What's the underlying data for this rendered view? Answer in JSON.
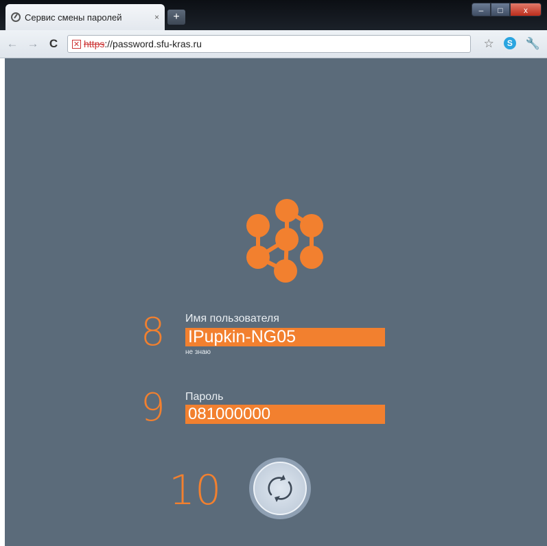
{
  "browser": {
    "tab_title": "Сервис смены паролей",
    "tab_close": "×",
    "new_tab": "+",
    "window_controls": {
      "minimize": "–",
      "maximize": "□",
      "close": "x"
    },
    "toolbar": {
      "back": "←",
      "forward": "→",
      "reload": "C",
      "url_scheme": "https",
      "url_rest": "://password.sfu-kras.ru"
    }
  },
  "page": {
    "background_color": "#5b6b7a",
    "accent_color": "#f2802f",
    "steps": {
      "username_step": "8",
      "password_step": "9",
      "submit_step": "10"
    },
    "username": {
      "label": "Имя пользователя",
      "value": "IPupkin-NG05",
      "hint": "не знаю"
    },
    "password": {
      "label": "Пароль",
      "value": "081000000"
    },
    "submit_icon": "refresh-icon"
  }
}
